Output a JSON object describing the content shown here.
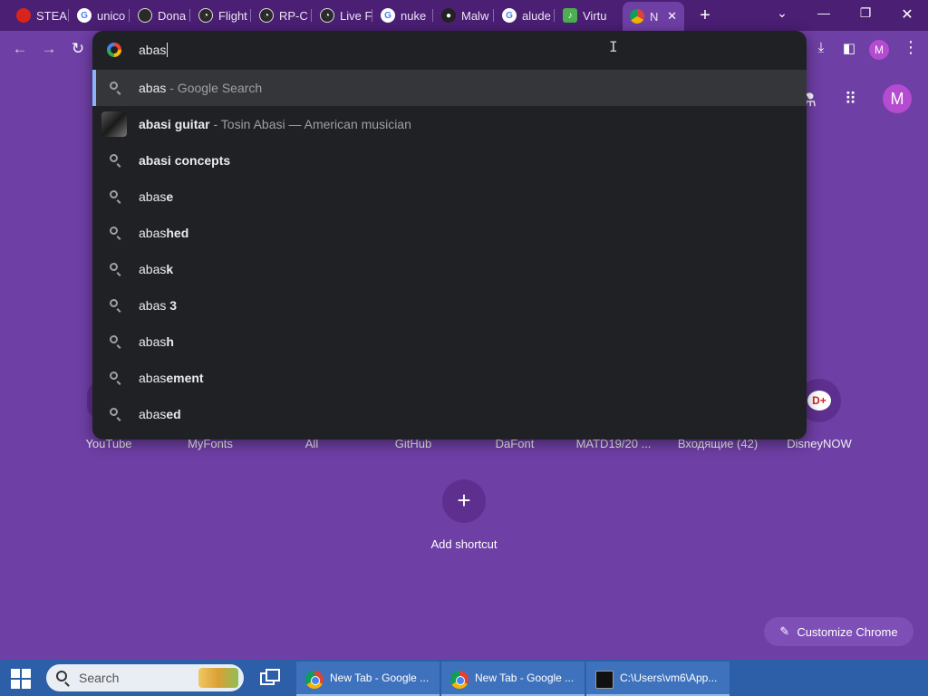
{
  "tabs": [
    {
      "label": "STEA",
      "icon": "steam-red-icon"
    },
    {
      "label": "unico",
      "icon": "google-g-icon"
    },
    {
      "label": "Dona",
      "icon": "generic-circle-icon"
    },
    {
      "label": "Flight",
      "icon": "radar-icon"
    },
    {
      "label": "RP-C",
      "icon": "radar-icon"
    },
    {
      "label": "Live F",
      "icon": "radar-icon"
    },
    {
      "label": "nuke",
      "icon": "google-g-icon"
    },
    {
      "label": "Malw",
      "icon": "github-icon"
    },
    {
      "label": "alude",
      "icon": "google-g-icon"
    },
    {
      "label": "Virtu",
      "icon": "music-note-icon"
    },
    {
      "label": "N",
      "icon": "chrome-icon"
    }
  ],
  "tab_close": "✕",
  "new_tab": "+",
  "window": {
    "minimize": "—",
    "maximize": "❐",
    "close": "✕",
    "tabsearch": "⌄"
  },
  "toolbar": {
    "back": "←",
    "forward": "→",
    "reload": "↻",
    "profile_initial": "M",
    "menu": "⋮"
  },
  "omnibox": {
    "typed_text": "abas",
    "suggestions": [
      {
        "typed": "abas",
        "rest": "",
        "desc": " - Google Search",
        "kind": "search",
        "selected": true
      },
      {
        "typed": "abas",
        "rest": "i guitar",
        "desc": " - Tosin Abasi — American musician",
        "kind": "entity",
        "selected": false
      },
      {
        "typed": "abas",
        "rest": "i concepts",
        "desc": "",
        "kind": "search",
        "selected": false
      },
      {
        "typed": "abas",
        "rest": "e",
        "desc": "",
        "kind": "search",
        "selected": false
      },
      {
        "typed": "abas",
        "rest": "hed",
        "desc": "",
        "kind": "search",
        "selected": false
      },
      {
        "typed": "abas",
        "rest": "k",
        "desc": "",
        "kind": "search",
        "selected": false
      },
      {
        "typed": "abas ",
        "rest": "3",
        "desc": "",
        "kind": "search",
        "selected": false
      },
      {
        "typed": "abas",
        "rest": "h",
        "desc": "",
        "kind": "search",
        "selected": false
      },
      {
        "typed": "abas",
        "rest": "ement",
        "desc": "",
        "kind": "search",
        "selected": false
      },
      {
        "typed": "abas",
        "rest": "ed",
        "desc": "",
        "kind": "search",
        "selected": false
      }
    ]
  },
  "ntp": {
    "profile_initial": "M",
    "shortcuts": [
      {
        "label": "YouTube"
      },
      {
        "label": "MyFonts"
      },
      {
        "label": "All"
      },
      {
        "label": "GitHub"
      },
      {
        "label": "DaFont"
      },
      {
        "label": "MATD19/20 ..."
      },
      {
        "label": "Входящие (42)"
      },
      {
        "label": "DisneyNOW"
      }
    ],
    "add_shortcut": "Add shortcut",
    "add_symbol": "+",
    "customize": "Customize Chrome",
    "customize_icon": "✎"
  },
  "taskbar": {
    "search_placeholder": "Search",
    "windows": [
      {
        "label": "New Tab - Google ...",
        "icon": "chrome-icon"
      },
      {
        "label": "New Tab - Google ...",
        "icon": "chrome-icon"
      },
      {
        "label": "C:\\Users\\vm6\\App...",
        "icon": "terminal-icon"
      }
    ]
  },
  "colors": {
    "theme": "#6e3fa5",
    "tabstrip": "#4a1f74",
    "omnibox_bg": "#202124",
    "taskbar": "#2d5ea8"
  }
}
